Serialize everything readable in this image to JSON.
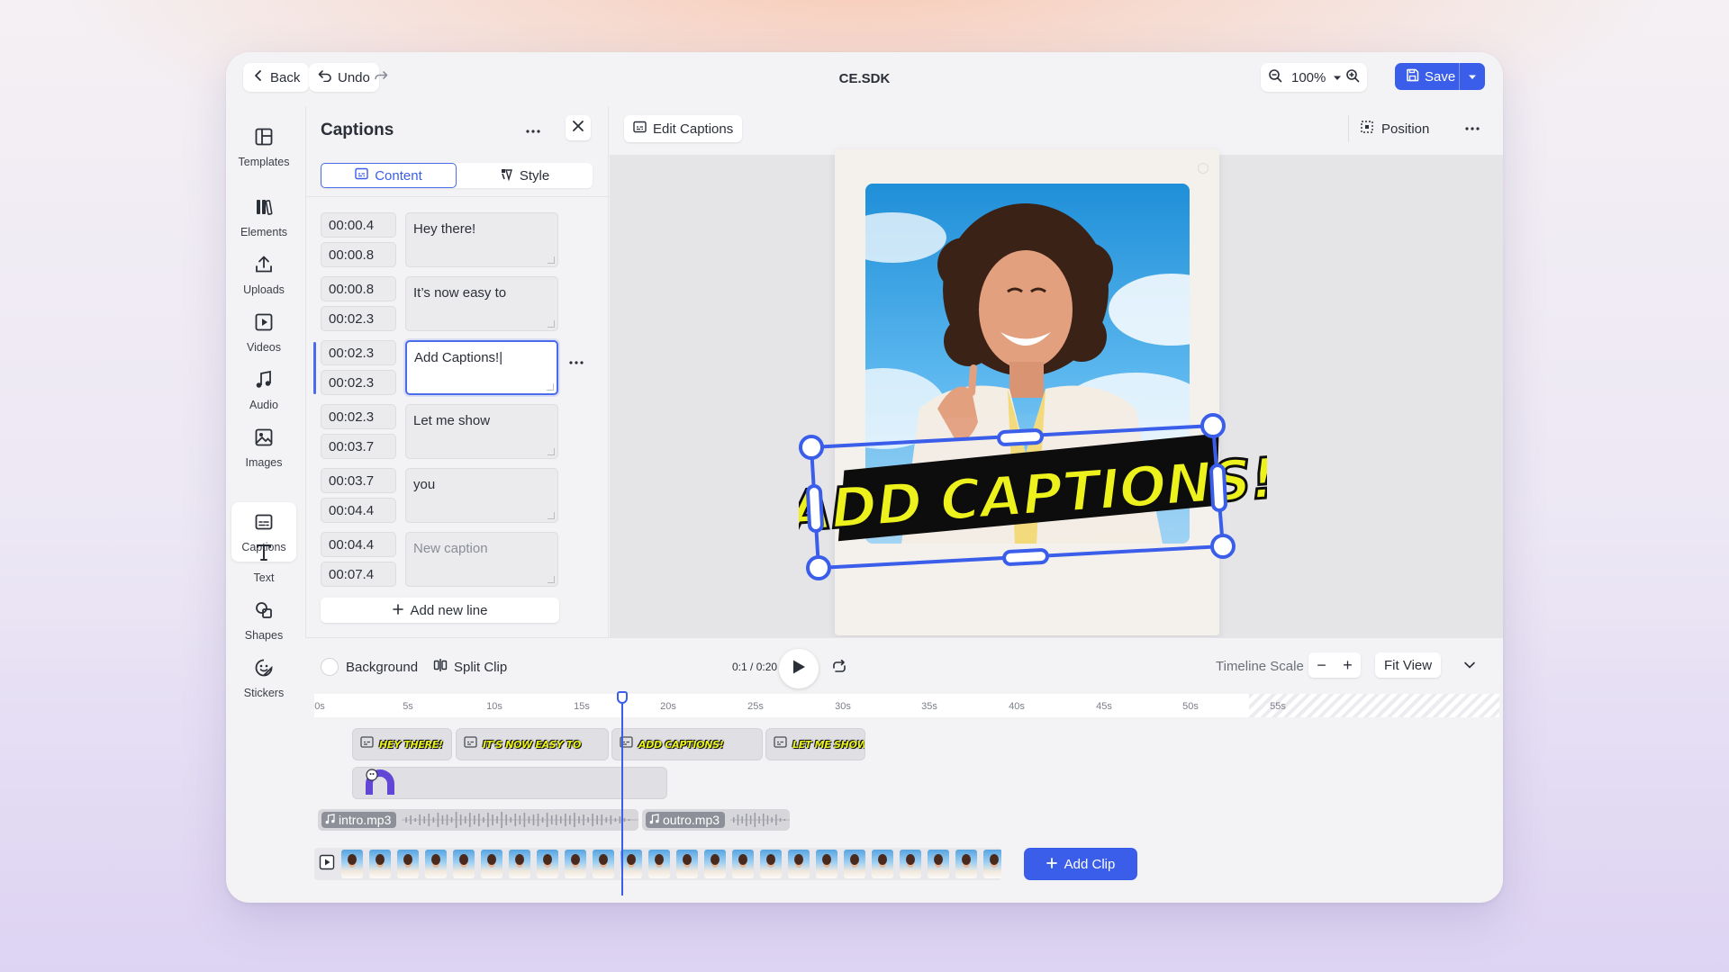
{
  "app": {
    "title": "CE.SDK",
    "back_label": "Back",
    "undo_label": "Undo",
    "zoom_value": "100%",
    "save_label": "Save",
    "accent_color": "#3a5ee9"
  },
  "sidebar": {
    "items": [
      {
        "label": "Templates",
        "icon": "templates-icon"
      },
      {
        "label": "Elements",
        "icon": "elements-icon"
      },
      {
        "label": "Uploads",
        "icon": "upload-icon"
      },
      {
        "label": "Videos",
        "icon": "video-icon"
      },
      {
        "label": "Audio",
        "icon": "music-note-icon"
      },
      {
        "label": "Images",
        "icon": "image-icon"
      },
      {
        "label": "Captions",
        "icon": "captions-icon",
        "active": true
      },
      {
        "label": "Text",
        "icon": "text-icon"
      },
      {
        "label": "Shapes",
        "icon": "shapes-icon"
      },
      {
        "label": "Stickers",
        "icon": "sticker-icon"
      }
    ]
  },
  "captions_panel": {
    "title": "Captions",
    "tabs": [
      {
        "label": "Content",
        "active": true
      },
      {
        "label": "Style",
        "active": false
      }
    ],
    "rows": [
      {
        "start": "00:00.4",
        "end": "00:00.8",
        "text": "Hey there!"
      },
      {
        "start": "00:00.8",
        "end": "00:02.3",
        "text": "It’s now easy to"
      },
      {
        "start": "00:02.3",
        "end": "00:02.3",
        "text": "Add Captions!|",
        "active": true
      },
      {
        "start": "00:02.3",
        "end": "00:03.7",
        "text": "Let me show"
      },
      {
        "start": "00:03.7",
        "end": "00:04.4",
        "text": "you"
      },
      {
        "start": "00:04.4",
        "end": "00:07.4",
        "text": "",
        "placeholder": "New caption"
      }
    ],
    "add_line_label": "Add new line"
  },
  "canvas": {
    "edit_captions_label": "Edit Captions",
    "position_label": "Position",
    "caption_overlay_text": "ADD CAPTIONS!",
    "caption_color": "#eef21c"
  },
  "timeline": {
    "background_label": "Background",
    "split_clip_label": "Split Clip",
    "current_time": "0:1",
    "separator": "/",
    "total_time": "0:20",
    "scale_label": "Timeline Scale",
    "fit_view_label": "Fit View",
    "ruler_ticks": [
      "0s",
      "5s",
      "10s",
      "15s",
      "20s",
      "25s",
      "30s",
      "35s",
      "40s",
      "45s",
      "50s",
      "55s"
    ],
    "caption_clips": [
      "HEY THERE!",
      "IT'S NOW EASY TO",
      "ADD CAPTIONS!",
      "LET ME SHOW"
    ],
    "audio_clips": [
      "intro.mp3",
      "outro.mp3"
    ],
    "add_clip_label": "Add Clip",
    "playhead_seconds": 14.5
  }
}
